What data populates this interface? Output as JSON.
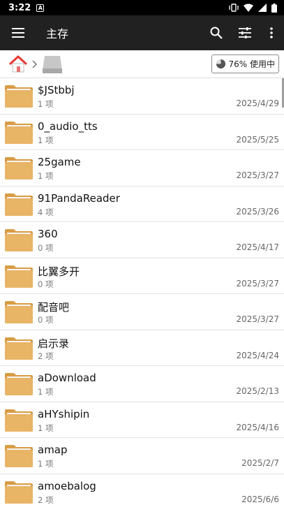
{
  "status": {
    "time": "3:22",
    "notif_glyph": "A"
  },
  "toolbar": {
    "title": "主存"
  },
  "pathbar": {
    "storage_label": "76% 使用中"
  },
  "files": [
    {
      "name": "$JStbbj",
      "count": "1 项",
      "date": "2025/4/29"
    },
    {
      "name": "0_audio_tts",
      "count": "1 项",
      "date": "2025/5/25"
    },
    {
      "name": "25game",
      "count": "1 项",
      "date": "2025/3/27"
    },
    {
      "name": "91PandaReader",
      "count": "4 项",
      "date": "2025/3/26"
    },
    {
      "name": "360",
      "count": "0 项",
      "date": "2025/4/17"
    },
    {
      "name": "比翼多开",
      "count": "0 项",
      "date": "2025/3/27"
    },
    {
      "name": "配音吧",
      "count": "0 项",
      "date": "2025/3/27"
    },
    {
      "name": "启示录",
      "count": "2 项",
      "date": "2025/4/24"
    },
    {
      "name": "aDownload",
      "count": "1 项",
      "date": "2025/2/13"
    },
    {
      "name": "aHYshipin",
      "count": "1 项",
      "date": "2025/4/16"
    },
    {
      "name": "amap",
      "count": "1 项",
      "date": "2025/2/7"
    },
    {
      "name": "amoebalog",
      "count": "2 项",
      "date": "2025/6/6"
    }
  ],
  "colors": {
    "toolbar": "#212121",
    "folder": "#e8b466",
    "folder_tab": "#d99c45"
  }
}
